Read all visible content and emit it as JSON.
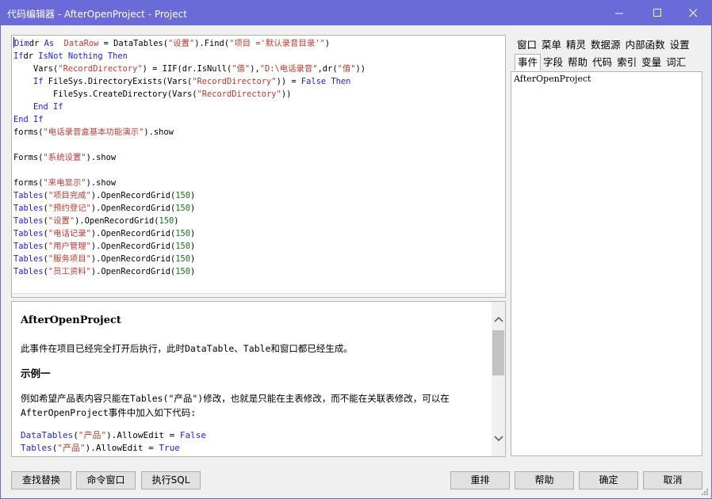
{
  "window": {
    "title": "代码编辑器 - AfterOpenProject - Project"
  },
  "editor": {
    "lines": [
      [
        [
          "kw",
          "Dim"
        ],
        [
          "",
          "dr "
        ],
        [
          "kw",
          "As"
        ],
        [
          "",
          "  "
        ],
        [
          "typ",
          "DataRow"
        ],
        [
          "",
          " = DataTables("
        ],
        [
          "str",
          "\"设置\""
        ],
        [
          "",
          ").Find("
        ],
        [
          "str",
          "\"项目 ='默认录音目录'\""
        ],
        [
          "",
          ")"
        ]
      ],
      [
        [
          "kw",
          "If"
        ],
        [
          "",
          "dr "
        ],
        [
          "kw",
          "IsNot Nothing Then"
        ]
      ],
      [
        [
          "",
          "    Vars("
        ],
        [
          "str",
          "\"RecordDirectory\""
        ],
        [
          "",
          ") = IIF(dr.IsNull("
        ],
        [
          "str",
          "\"值\""
        ],
        [
          "",
          "),"
        ],
        [
          "str",
          "\"D:\\电话录音\""
        ],
        [
          "",
          ",dr("
        ],
        [
          "str",
          "\"值\""
        ],
        [
          "",
          "))"
        ]
      ],
      [
        [
          "kw",
          "    If"
        ],
        [
          "",
          " FileSys.DirectoryExists(Vars("
        ],
        [
          "str",
          "\"RecordDirectory\""
        ],
        [
          "",
          ")) = "
        ],
        [
          "kw",
          "False Then"
        ]
      ],
      [
        [
          "",
          "        FileSys.CreateDirectory(Vars("
        ],
        [
          "str",
          "\"RecordDirectory\""
        ],
        [
          "",
          "))"
        ]
      ],
      [
        [
          "kw",
          "    End If"
        ]
      ],
      [
        [
          "kw",
          "End If"
        ]
      ],
      [
        [
          "",
          "forms("
        ],
        [
          "str",
          "\"电话录音盒基本功能演示\""
        ],
        [
          "",
          ").show"
        ]
      ],
      [
        [
          "",
          ""
        ]
      ],
      [
        [
          "",
          "Forms("
        ],
        [
          "str",
          "\"系统设置\""
        ],
        [
          "",
          ").show"
        ]
      ],
      [
        [
          "",
          ""
        ]
      ],
      [
        [
          "",
          "forms("
        ],
        [
          "str",
          "\"来电显示\""
        ],
        [
          "",
          ").show"
        ]
      ],
      [
        [
          "kw",
          "Tables"
        ],
        [
          "",
          "("
        ],
        [
          "str",
          "\"项目完成\""
        ],
        [
          "",
          ").OpenRecordGrid("
        ],
        [
          "num",
          "150"
        ],
        [
          "",
          ")"
        ]
      ],
      [
        [
          "kw",
          "Tables"
        ],
        [
          "",
          "("
        ],
        [
          "str",
          "\"预约登记\""
        ],
        [
          "",
          ").OpenRecordGrid("
        ],
        [
          "num",
          "150"
        ],
        [
          "",
          ")"
        ]
      ],
      [
        [
          "kw",
          "Tables"
        ],
        [
          "",
          "("
        ],
        [
          "str",
          "\"设置\""
        ],
        [
          "",
          ").OpenRecordGrid("
        ],
        [
          "num",
          "150"
        ],
        [
          "",
          ")"
        ]
      ],
      [
        [
          "kw",
          "Tables"
        ],
        [
          "",
          "("
        ],
        [
          "str",
          "\"电话记录\""
        ],
        [
          "",
          ").OpenRecordGrid("
        ],
        [
          "num",
          "150"
        ],
        [
          "",
          ")"
        ]
      ],
      [
        [
          "kw",
          "Tables"
        ],
        [
          "",
          "("
        ],
        [
          "str",
          "\"用户管理\""
        ],
        [
          "",
          ").OpenRecordGrid("
        ],
        [
          "num",
          "150"
        ],
        [
          "",
          ")"
        ]
      ],
      [
        [
          "kw",
          "Tables"
        ],
        [
          "",
          "("
        ],
        [
          "str",
          "\"服务项目\""
        ],
        [
          "",
          ").OpenRecordGrid("
        ],
        [
          "num",
          "150"
        ],
        [
          "",
          ")"
        ]
      ],
      [
        [
          "kw",
          "Tables"
        ],
        [
          "",
          "("
        ],
        [
          "str",
          "\"员工资料\""
        ],
        [
          "",
          ").OpenRecordGrid("
        ],
        [
          "num",
          "150"
        ],
        [
          "",
          ")"
        ]
      ]
    ]
  },
  "help": {
    "title": "AfterOpenProject",
    "intro": "此事件在项目已经完全打开后执行，此时DataTable、Table和窗口都已经生成。",
    "example_heading": "示例一",
    "example_text": "例如希望产品表内容只能在Tables(\"产品\")修改，也就是只能在主表修改，而不能在关联表修改，可以在AfterOpenProject事件中加入如下代码:",
    "code_lines": [
      [
        [
          "kw",
          "DataTables"
        ],
        [
          "",
          "("
        ],
        [
          "str",
          "\"产品\""
        ],
        [
          "",
          ").AllowEdit = "
        ],
        [
          "kw",
          "False"
        ]
      ],
      [
        [
          "kw",
          "Tables"
        ],
        [
          "",
          "("
        ],
        [
          "str",
          "\"产品\""
        ],
        [
          "",
          ").AllowEdit = "
        ],
        [
          "kw",
          "True"
        ]
      ]
    ]
  },
  "side_tabs": {
    "row1": [
      "窗口",
      "菜单",
      "精灵",
      "数据源",
      "内部函数",
      "设置"
    ],
    "row2": [
      "事件",
      "字段",
      "帮助",
      "代码",
      "索引",
      "变量",
      "词汇"
    ],
    "active": "事件"
  },
  "side_list": {
    "items": [
      "AfterOpenProject"
    ]
  },
  "buttons": {
    "find_replace": "查找替换",
    "command_window": "命令窗口",
    "execute_sql": "执行SQL",
    "reorder": "重排",
    "help": "帮助",
    "ok": "确定",
    "cancel": "取消"
  },
  "colors": {
    "titlebar": "#6a6ad8",
    "keyword": "#1a1aff",
    "string": "#c0392b",
    "number": "#0a7a0a"
  }
}
